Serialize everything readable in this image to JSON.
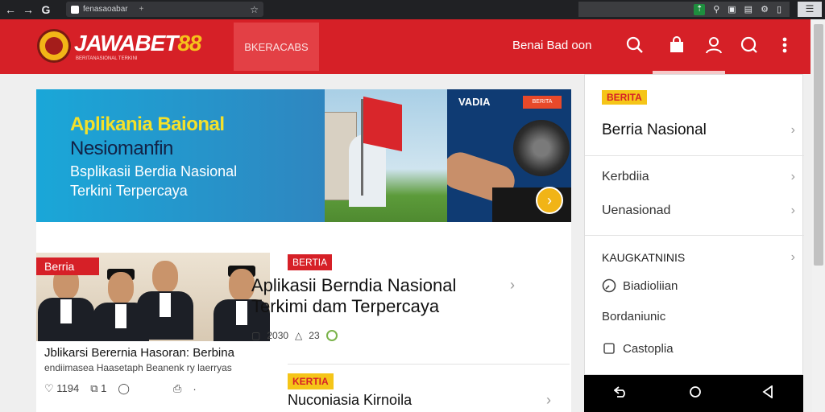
{
  "browser": {
    "url": "fenasaoabar",
    "tab_symbol": "+",
    "menu": "⋮"
  },
  "header": {
    "brand_main": "JAWABET",
    "brand_num": "88",
    "brand_sub": "BERITANASIONAL TERKINI",
    "promo_text": "BKERACABS",
    "nav_link": "Benai Bad oon"
  },
  "hero": {
    "line1": "Aplikania Baional",
    "line2": "Nesiomanfin",
    "line3": "Bsplikasii Berdia Nasional",
    "line4": "Terkini Terpercaya",
    "right_label": "VADIA",
    "right_badge": "BERITA"
  },
  "news1": {
    "badge": "Berria",
    "caption": "Jblikarsi  Berernia Hasoran:  Berbina",
    "subcaption": "endiimasea  Haasetaph Beanenk  ry laerryas",
    "stats": {
      "likes": "1194",
      "shares": "1",
      "comments": "",
      "saves": ""
    }
  },
  "news_main": {
    "tag": "BERTIA",
    "title_line1": "Aplikasii Berndia Nasional",
    "title_line2": "Terkimi dam Terpercaya",
    "views": "2030",
    "likes": "23"
  },
  "news2": {
    "tag": "KERTIA",
    "title": "Nuconiasia Kirnoila"
  },
  "sidebar": {
    "tag": "BERITA",
    "item1": "Berria Nasional",
    "item2": "Kerbdiia",
    "item3": "Uenasionad",
    "section_title": "KAUGKATNINIS",
    "sub1": "Biadioliian",
    "sub2": "Bordaniunic",
    "sub3": "Castoplia"
  },
  "colors": {
    "brand_red": "#d62027",
    "accent_yellow": "#f5c518",
    "hero_blue": "#1aa7d8"
  }
}
